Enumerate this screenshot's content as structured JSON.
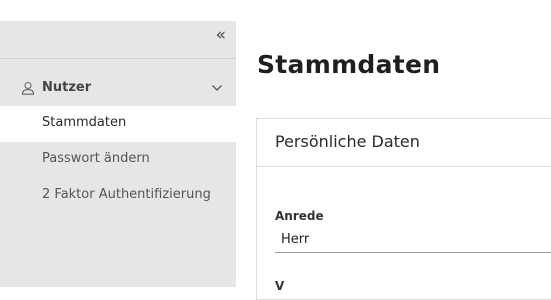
{
  "sidebar": {
    "collapse_icon": "double-chevron-left-icon",
    "collapse_glyph": "«",
    "group": {
      "icon": "user-icon",
      "label": "Nutzer",
      "chevron_icon": "chevron-down-icon"
    },
    "items": [
      {
        "label": "Stammdaten",
        "active": true
      },
      {
        "label": "Passwort ändern",
        "active": false
      },
      {
        "label": "2 Faktor Authentifizierung",
        "active": false
      }
    ]
  },
  "main": {
    "title": "Stammdaten",
    "card": {
      "title": "Persönliche Daten",
      "fields": [
        {
          "label": "Anrede",
          "value": "Herr"
        },
        {
          "label": "V"
        }
      ]
    }
  },
  "colors": {
    "sidebar_bg": "#e6e6e6",
    "active_item_bg": "#ffffff",
    "text": "#2b2b2b"
  }
}
